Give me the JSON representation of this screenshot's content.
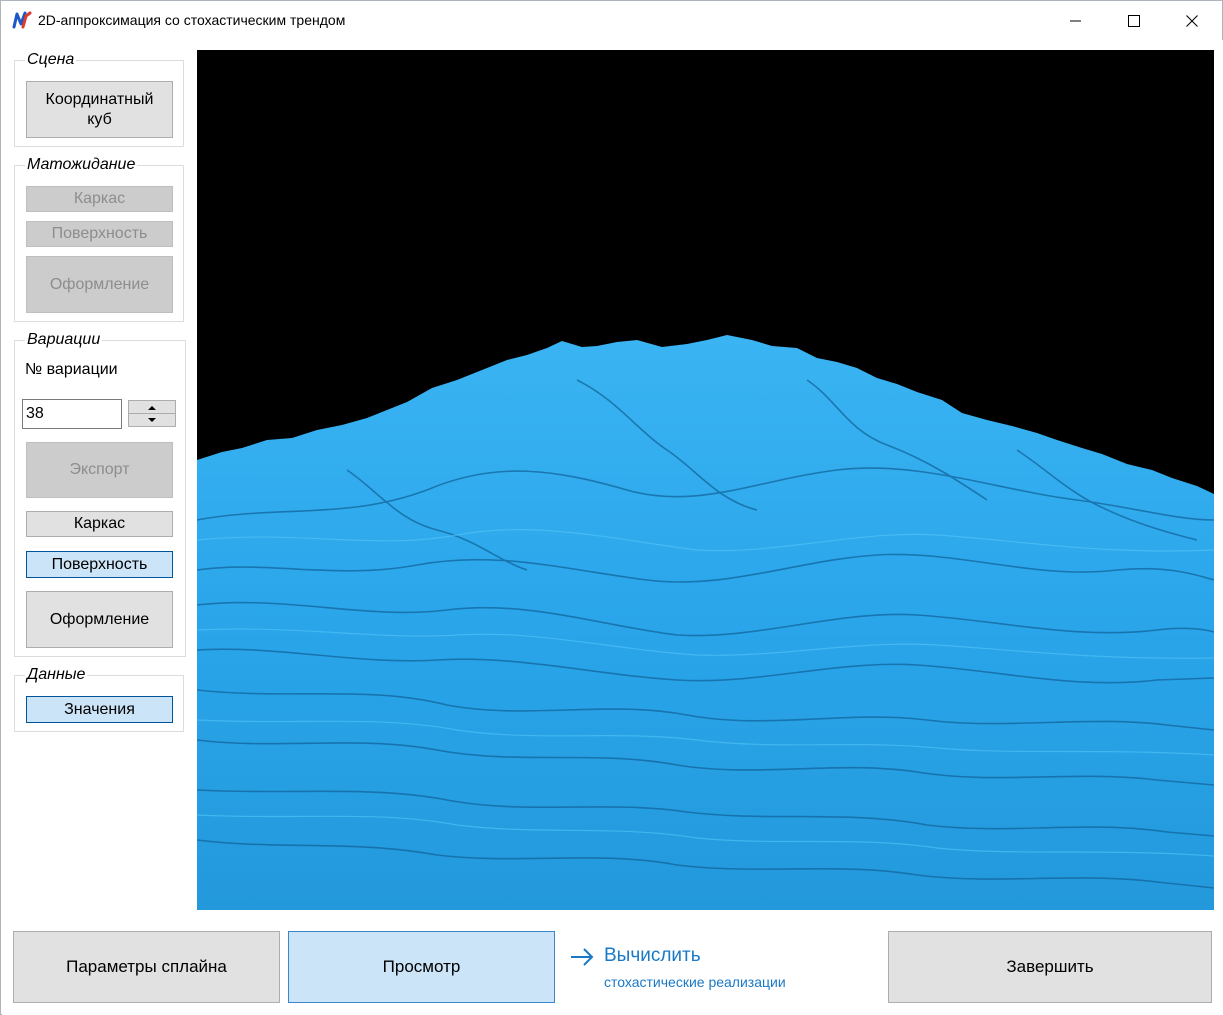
{
  "window": {
    "title": "2D-аппроксимация со стохастическим трендом"
  },
  "groups": {
    "scene": {
      "legend": "Сцена",
      "coord_cube_label": "Координатный куб"
    },
    "expectation": {
      "legend": "Матожидание",
      "frame_label": "Каркас",
      "surface_label": "Поверхность",
      "design_label": "Оформление"
    },
    "variations": {
      "legend": "Вариации",
      "number_label": "№ вариации",
      "number_value": "38",
      "export_label": "Экспорт",
      "frame_label": "Каркас",
      "surface_label": "Поверхность",
      "design_label": "Оформление"
    },
    "data": {
      "legend": "Данные",
      "values_label": "Значения"
    }
  },
  "bottom": {
    "spline_params_label": "Параметры сплайна",
    "preview_label": "Просмотр",
    "compute_main": "Вычислить",
    "compute_sub": "стохастические реализации",
    "finish_label": "Завершить"
  },
  "colors": {
    "surface": "#2aa5ea",
    "surface_dark": "#1473b0",
    "viewport_bg": "#000000",
    "accent": "#1a79c7",
    "active_button": "#cce4f7"
  },
  "icons": {
    "app": "app-logo-icon",
    "minimize": "minimize-icon",
    "maximize": "maximize-icon",
    "close": "close-icon",
    "arrow": "arrow-right-icon",
    "spin_up": "spin-up-icon",
    "spin_down": "spin-down-icon"
  }
}
